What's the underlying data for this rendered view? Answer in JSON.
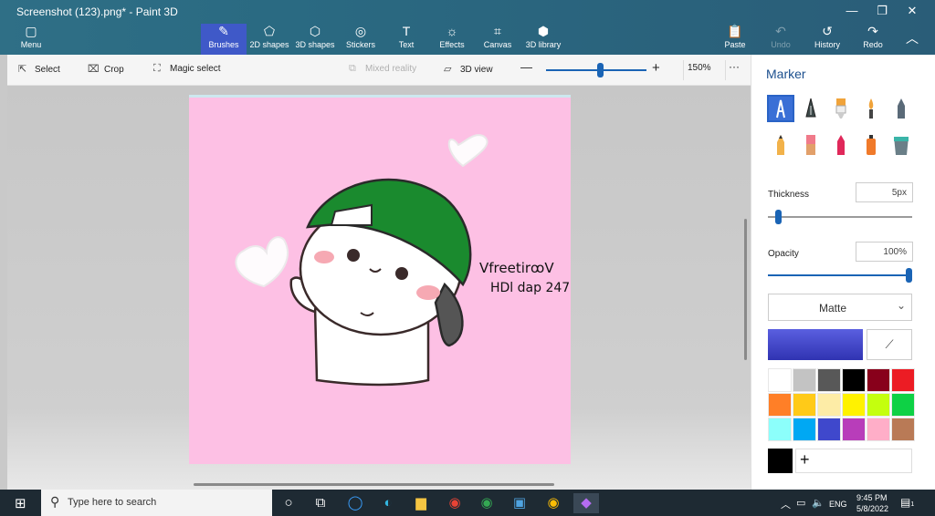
{
  "window": {
    "title": "Screenshot (123).png* - Paint 3D"
  },
  "ribbon": {
    "menu": "Menu",
    "tools": [
      {
        "label": "Brushes",
        "icon": "brush-icon",
        "active": true
      },
      {
        "label": "2D shapes",
        "icon": "2d-shapes-icon"
      },
      {
        "label": "3D shapes",
        "icon": "3d-shapes-icon"
      },
      {
        "label": "Stickers",
        "icon": "stickers-icon"
      },
      {
        "label": "Text",
        "icon": "text-icon"
      },
      {
        "label": "Effects",
        "icon": "effects-icon"
      },
      {
        "label": "Canvas",
        "icon": "canvas-icon"
      },
      {
        "label": "3D library",
        "icon": "3d-library-icon"
      }
    ],
    "paste": "Paste",
    "undo": "Undo",
    "history": "History",
    "redo": "Redo"
  },
  "toolbar": {
    "select": "Select",
    "crop": "Crop",
    "magic_select": "Magic select",
    "mixed_reality": "Mixed reality",
    "view_3d": "3D view",
    "zoom": "150%",
    "more": "···"
  },
  "canvas": {
    "bg_color": "#fdc0e4",
    "caption_line1": "VfreetirꝏV",
    "caption_line2": "HDl dap 247"
  },
  "panel": {
    "title": "Marker",
    "brush_icons": [
      "marker-icon",
      "calligraphy-pen-icon",
      "oil-brush-icon",
      "watercolor-icon",
      "pixel-pen-icon",
      "pencil-icon",
      "eraser-icon",
      "crayon-icon",
      "spray-can-icon",
      "fill-bucket-icon"
    ],
    "thickness_label": "Thickness",
    "thickness_value": "5px",
    "thickness_fraction": 0.05,
    "opacity_label": "Opacity",
    "opacity_value": "100%",
    "opacity_fraction": 1.0,
    "finish": "Matte",
    "current_color": "#3d41c9",
    "palette": [
      "#ffffff",
      "#c3c3c3",
      "#585858",
      "#000000",
      "#88001b",
      "#ec1c24",
      "#ff7f27",
      "#ffca18",
      "#fdeca6",
      "#fff200",
      "#c4ff0e",
      "#0ed145",
      "#8cfffb",
      "#00a8f3",
      "#3f48cc",
      "#b83dba",
      "#ffaec8",
      "#b97a56"
    ],
    "custom_color": "#000000",
    "add_color": "+"
  },
  "taskbar": {
    "search_placeholder": "Type here to search",
    "time": "9:45 PM",
    "date": "5/8/2022",
    "lang": "ENG",
    "notifications": "1"
  }
}
